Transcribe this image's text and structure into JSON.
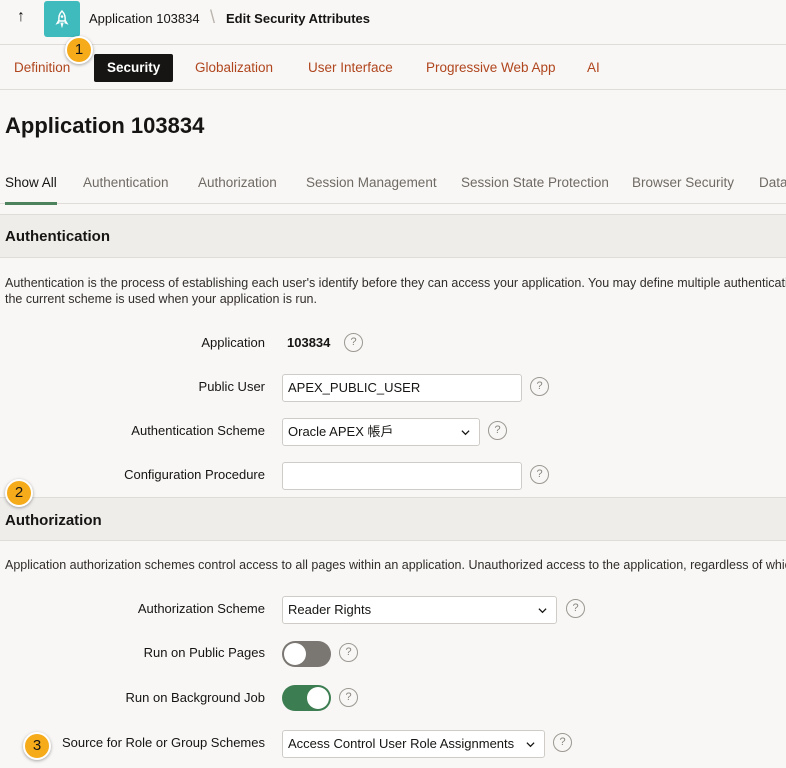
{
  "breadcrumb": {
    "app_title": "Application 103834",
    "separator": "\\",
    "page_title": "Edit Security Attributes"
  },
  "top_tabs": [
    {
      "label": "Definition",
      "active": false
    },
    {
      "label": "Security",
      "active": true
    },
    {
      "label": "Globalization",
      "active": false
    },
    {
      "label": "User Interface",
      "active": false
    },
    {
      "label": "Progressive Web App",
      "active": false
    },
    {
      "label": "AI",
      "active": false
    }
  ],
  "markers": [
    "1",
    "2",
    "3"
  ],
  "page_title": "Application 103834",
  "region_tabs": [
    {
      "label": "Show All",
      "active": true
    },
    {
      "label": "Authentication",
      "active": false
    },
    {
      "label": "Authorization",
      "active": false
    },
    {
      "label": "Session Management",
      "active": false
    },
    {
      "label": "Session State Protection",
      "active": false
    },
    {
      "label": "Browser Security",
      "active": false
    },
    {
      "label": "Data",
      "active": false
    }
  ],
  "authentication": {
    "title": "Authentication",
    "description_line1": "Authentication is the process of establishing each user's identify before they can access your application. You may define multiple authentication schemes for your application, however only",
    "description_line2": "the current scheme is used when your application is run.",
    "application_label": "Application",
    "application_value": "103834",
    "public_user_label": "Public User",
    "public_user_value": "APEX_PUBLIC_USER",
    "auth_scheme_label": "Authentication Scheme",
    "auth_scheme_value": "Oracle APEX 帳戶",
    "config_proc_label": "Configuration Procedure",
    "config_proc_value": ""
  },
  "authorization": {
    "title": "Authorization",
    "description": "Application authorization schemes control access to all pages within an application. Unauthorized access to the application, regardless of which page is requested, will cause an error page to display.",
    "authz_scheme_label": "Authorization Scheme",
    "authz_scheme_value": "Reader Rights",
    "run_public_label": "Run on Public Pages",
    "run_public_on": false,
    "run_background_label": "Run on Background Job",
    "run_background_on": true,
    "source_role_label": "Source for Role or Group Schemes",
    "source_role_value": "Access Control User Role Assignments"
  },
  "help_glyph": "?",
  "up_arrow_glyph": "↑",
  "icons": [
    "up-arrow-icon",
    "rocket-icon",
    "chevron-down-icon",
    "help-icon"
  ],
  "colors": {
    "accent_link": "#b0461e",
    "active_tab_bg": "#161513",
    "toggle_on": "#3d7d52",
    "toggle_off": "#7a7672",
    "app_icon_bg": "#3fbbbe",
    "marker": "#f6ab1b"
  }
}
